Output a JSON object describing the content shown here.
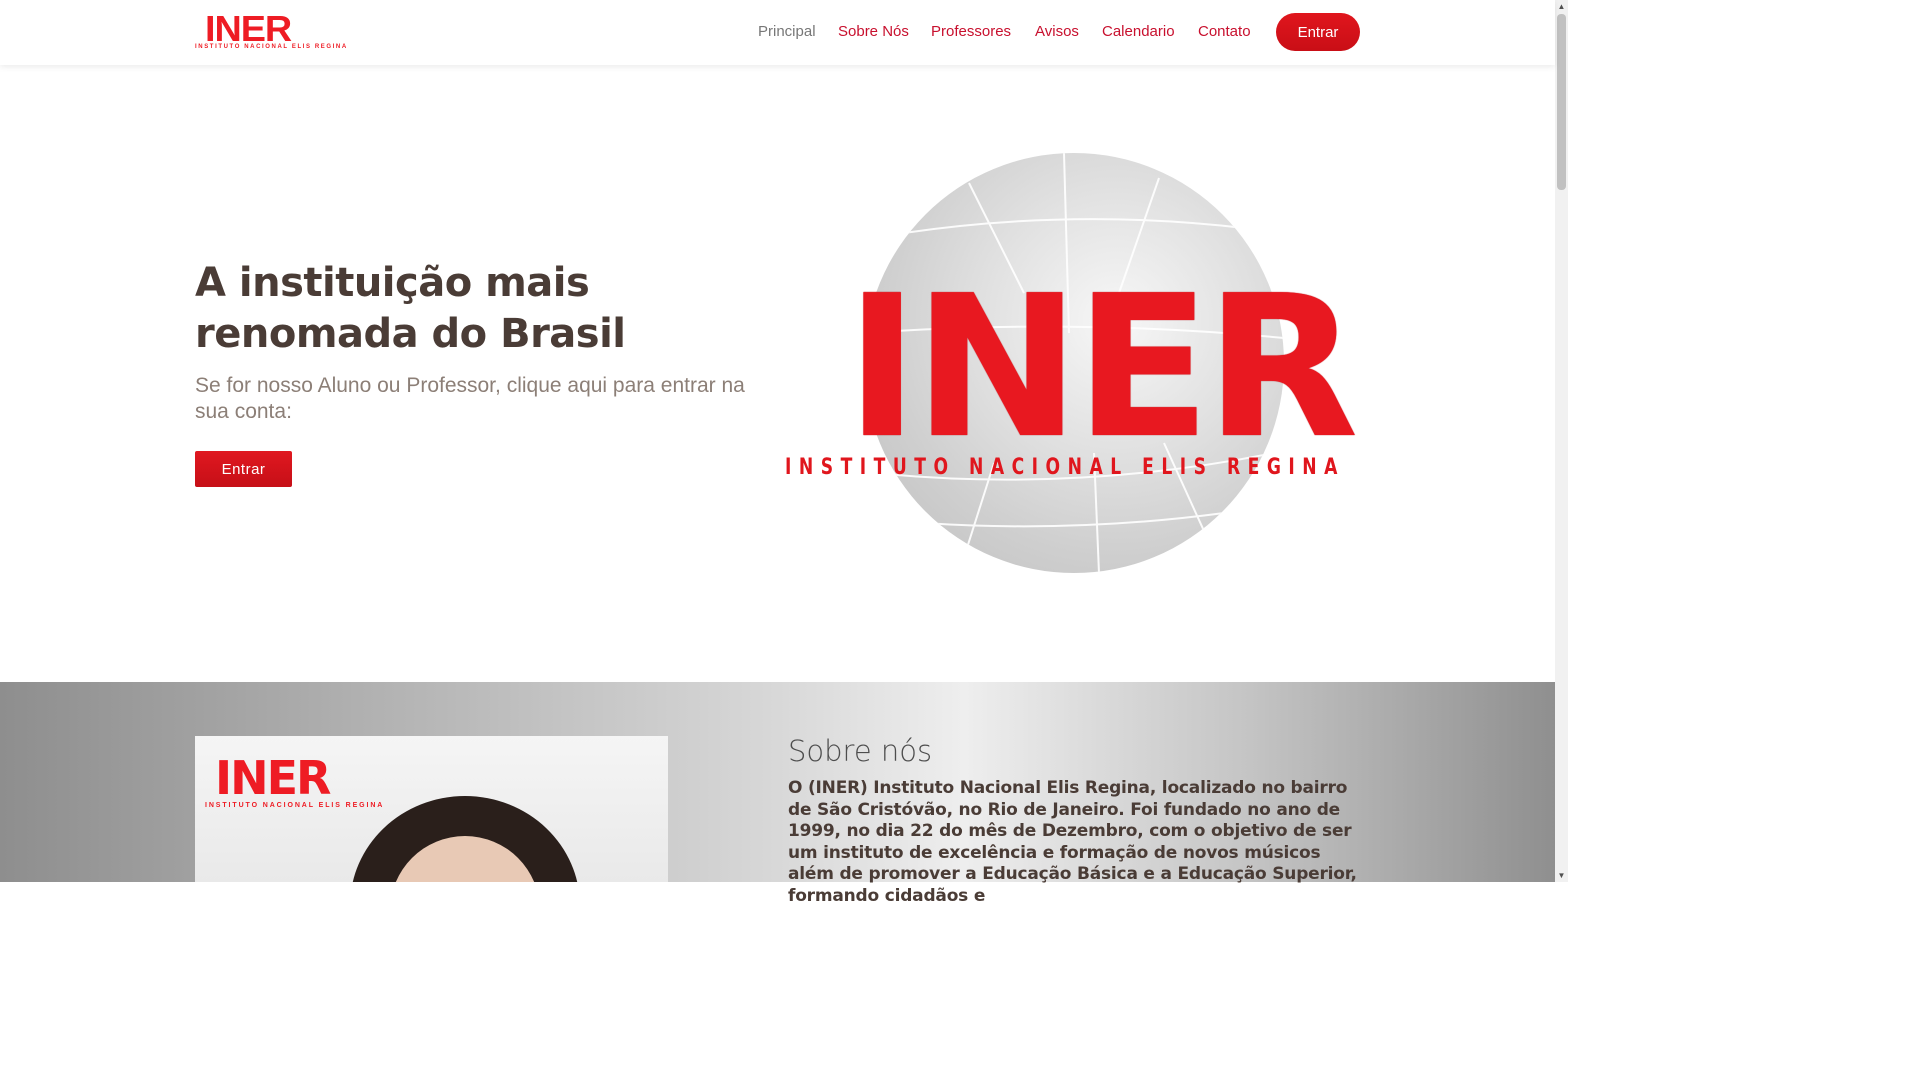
{
  "header": {
    "logo_text": "INER",
    "logo_tagline": "INSTITUTO NACIONAL ELIS REGINA",
    "nav": [
      {
        "label": "Principal"
      },
      {
        "label": "Sobre Nós"
      },
      {
        "label": "Professores"
      },
      {
        "label": "Avisos"
      },
      {
        "label": "Calendario"
      },
      {
        "label": "Contato"
      }
    ],
    "login_button": "Entrar"
  },
  "hero": {
    "title": "A instituição mais renomada do Brasil",
    "subtitle": "Se for nosso Aluno ou Professor, clique aqui para entrar na sua conta:",
    "button": "Entrar",
    "logo_text": "INER",
    "logo_tagline": "INSTITUTO NACIONAL ELIS REGINA"
  },
  "about": {
    "photo_logo_text": "INER",
    "photo_logo_tagline": "INSTITUTO NACIONAL ELIS REGINA",
    "title": "Sobre nós",
    "text": "O (INER) Instituto Nacional Elis Regina, localizado no bairro de São Cristóvão, no Rio de Janeiro. Foi fundado no ano de 1999, no dia 22 do mês de Dezembro, com o objetivo de ser um instituto de excelência e formação de novos músicos além de promover a Educação Básica e a Educação Superior, formando cidadãos e"
  },
  "colors": {
    "brand_red": "#e0161d",
    "text_dark": "#4a3c36",
    "nav_current": "#777777"
  }
}
